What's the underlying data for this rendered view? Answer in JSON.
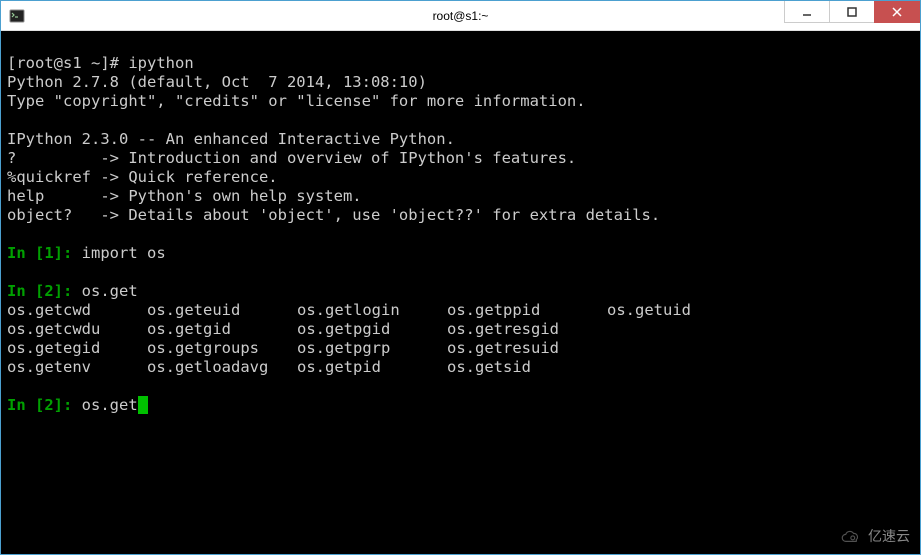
{
  "window": {
    "title": "root@s1:~"
  },
  "terminal": {
    "shell_prompt": "[root@s1 ~]# ",
    "shell_command": "ipython",
    "python_version_line": "Python 2.7.8 (default, Oct  7 2014, 13:08:10)",
    "type_line": "Type \"copyright\", \"credits\" or \"license\" for more information.",
    "ipython_banner": "IPython 2.3.0 -- An enhanced Interactive Python.",
    "help_q": "?         -> Introduction and overview of IPython's features.",
    "help_quickref": "%quickref -> Quick reference.",
    "help_help": "help      -> Python's own help system.",
    "help_object": "object?   -> Details about 'object', use 'object??' for extra details.",
    "in1": {
      "label_open": "In [",
      "num": "1",
      "label_close": "]:",
      "code": " import os"
    },
    "in2": {
      "label_open": "In [",
      "num": "2",
      "label_close": "]:",
      "code": " os.get"
    },
    "completions": [
      "os.getcwd",
      "os.geteuid",
      "os.getlogin",
      "os.getppid",
      "os.getuid",
      "os.getcwdu",
      "os.getgid",
      "os.getpgid",
      "os.getresgid",
      "",
      "os.getegid",
      "os.getgroups",
      "os.getpgrp",
      "os.getresuid",
      "",
      "os.getenv",
      "os.getloadavg",
      "os.getpid",
      "os.getsid",
      ""
    ],
    "in2b": {
      "label_open": "In [",
      "num": "2",
      "label_close": "]:",
      "code": " os.get"
    }
  },
  "watermark": {
    "text": "亿速云"
  }
}
